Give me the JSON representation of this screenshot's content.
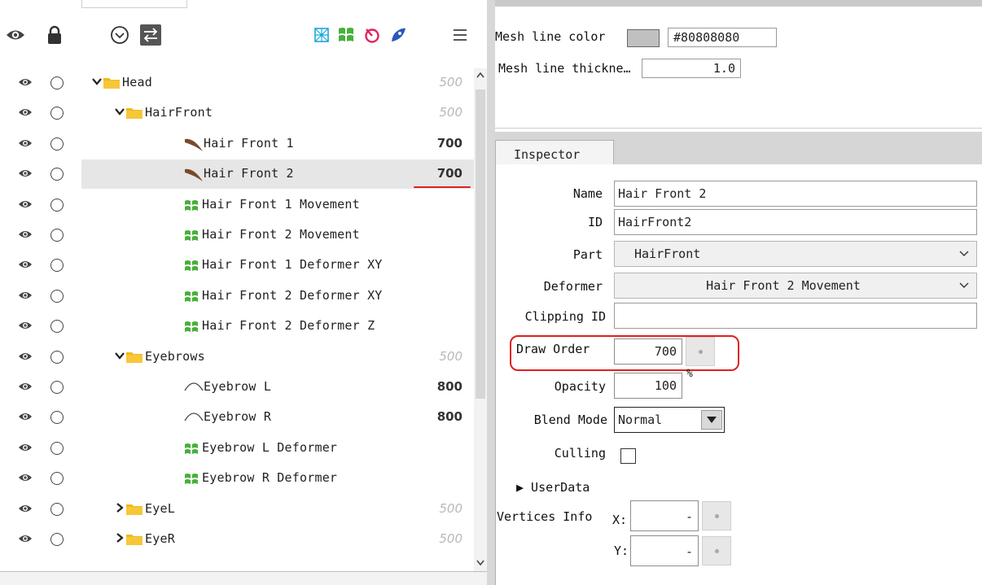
{
  "toolbar": {
    "left_icons": [
      "eye-icon",
      "lock-icon",
      "expand-circle-icon",
      "swap-icon"
    ],
    "right_icons": [
      "art-mesh-filter-icon",
      "warp-deformer-filter-icon",
      "rotation-deformer-filter-icon",
      "glue-filter-icon",
      "menu-icon"
    ]
  },
  "tree": {
    "rows": [
      {
        "indent": 0,
        "chevron": "down",
        "icon": "folder-icon",
        "label": "Head",
        "value": "500",
        "value_style": "dim"
      },
      {
        "indent": 1,
        "chevron": "down",
        "icon": "folder-icon",
        "label": "HairFront",
        "value": "500",
        "value_style": "dim"
      },
      {
        "indent": 2,
        "chevron": "",
        "icon": "art-mesh-icon",
        "label": "Hair Front 1",
        "value": "700",
        "value_style": "bold"
      },
      {
        "indent": 2,
        "chevron": "",
        "icon": "art-mesh-icon",
        "label": "Hair Front 2",
        "value": "700",
        "value_style": "bold",
        "selected": true
      },
      {
        "indent": 2,
        "chevron": "",
        "icon": "warp-deformer-icon",
        "label": "Hair Front 1 Movement",
        "value": "",
        "value_style": ""
      },
      {
        "indent": 2,
        "chevron": "",
        "icon": "warp-deformer-icon",
        "label": "Hair Front 2 Movement",
        "value": "",
        "value_style": ""
      },
      {
        "indent": 2,
        "chevron": "",
        "icon": "warp-deformer-icon",
        "label": "Hair Front 1 Deformer XY",
        "value": "",
        "value_style": ""
      },
      {
        "indent": 2,
        "chevron": "",
        "icon": "warp-deformer-icon",
        "label": "Hair Front 2 Deformer XY",
        "value": "",
        "value_style": ""
      },
      {
        "indent": 2,
        "chevron": "",
        "icon": "warp-deformer-icon",
        "label": "Hair Front 2 Deformer Z",
        "value": "",
        "value_style": ""
      },
      {
        "indent": 1,
        "chevron": "down",
        "icon": "folder-icon",
        "label": "Eyebrows",
        "value": "500",
        "value_style": "dim"
      },
      {
        "indent": 2,
        "chevron": "",
        "icon": "curve-mesh-icon",
        "label": "Eyebrow L",
        "value": "800",
        "value_style": "bold"
      },
      {
        "indent": 2,
        "chevron": "",
        "icon": "curve-mesh-icon",
        "label": "Eyebrow R",
        "value": "800",
        "value_style": "bold"
      },
      {
        "indent": 2,
        "chevron": "",
        "icon": "warp-deformer-icon",
        "label": "Eyebrow L Deformer",
        "value": "",
        "value_style": ""
      },
      {
        "indent": 2,
        "chevron": "",
        "icon": "warp-deformer-icon",
        "label": "Eyebrow R Deformer",
        "value": "",
        "value_style": ""
      },
      {
        "indent": 1,
        "chevron": "right",
        "icon": "folder-icon",
        "label": "EyeL",
        "value": "500",
        "value_style": "dim"
      },
      {
        "indent": 1,
        "chevron": "right",
        "icon": "folder-icon",
        "label": "EyeR",
        "value": "500",
        "value_style": "dim"
      }
    ]
  },
  "mesh": {
    "line_color_label": "Mesh line color",
    "line_color_value": "#80808080",
    "line_thickness_label": "Mesh line thickne…",
    "line_thickness_value": "1.0"
  },
  "inspector": {
    "tab_label": "Inspector",
    "name_label": "Name",
    "name_value": "Hair Front 2",
    "id_label": "ID",
    "id_value": "HairFront2",
    "part_label": "Part",
    "part_value": "HairFront",
    "deformer_label": "Deformer",
    "deformer_value": "Hair Front 2 Movement",
    "clipping_label": "Clipping ID",
    "clipping_value": "",
    "draw_order_label": "Draw Order",
    "draw_order_value": "700",
    "opacity_label": "Opacity",
    "opacity_value": "100",
    "opacity_unit": "%",
    "blend_label": "Blend Mode",
    "blend_value": "Normal",
    "culling_label": "Culling",
    "userdata_label": "▶ UserData",
    "vertices_label": "Vertices Info",
    "x_label": "X:",
    "x_value": "-",
    "y_label": "Y:",
    "y_value": "-"
  },
  "colors": {
    "selection_bg": "#e6e6e6",
    "highlight_red": "#e01f1f",
    "folder_yellow": "#f2b81a",
    "deformer_green": "#47b03a",
    "panel_gray": "#d8d8d8"
  }
}
